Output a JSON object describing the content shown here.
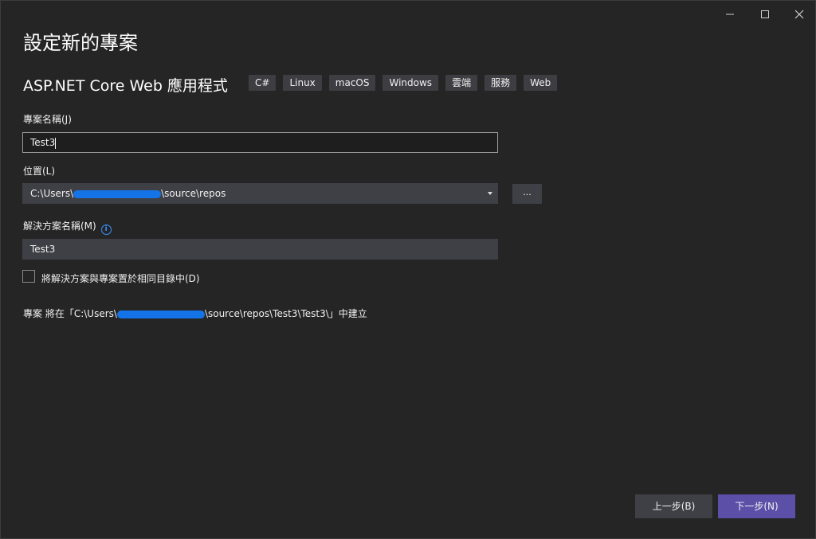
{
  "dialog": {
    "title": "設定新的專案",
    "template_name": "ASP.NET Core Web 應用程式",
    "tags": [
      "C#",
      "Linux",
      "macOS",
      "Windows",
      "雲端",
      "服務",
      "Web"
    ]
  },
  "project_name": {
    "label": "專案名稱(J)",
    "value": "Test3"
  },
  "location": {
    "label": "位置(L)",
    "prefix": "C:\\Users\\",
    "suffix": "\\source\\repos",
    "browse_label": "..."
  },
  "solution_name": {
    "label": "解決方案名稱(M)",
    "value": "Test3"
  },
  "same_directory": {
    "label": "將解決方案與專案置於相同目錄中(D)",
    "checked": false
  },
  "path_summary": {
    "before": "專案 將在「C:\\Users\\",
    "after": "\\source\\repos\\Test3\\Test3\\」中建立"
  },
  "buttons": {
    "back": "上一步(B)",
    "next": "下一步(N)"
  },
  "colors": {
    "background": "#252526",
    "accent": "#5b4fa8",
    "redaction": "#1473e6",
    "info": "#3794ff"
  }
}
